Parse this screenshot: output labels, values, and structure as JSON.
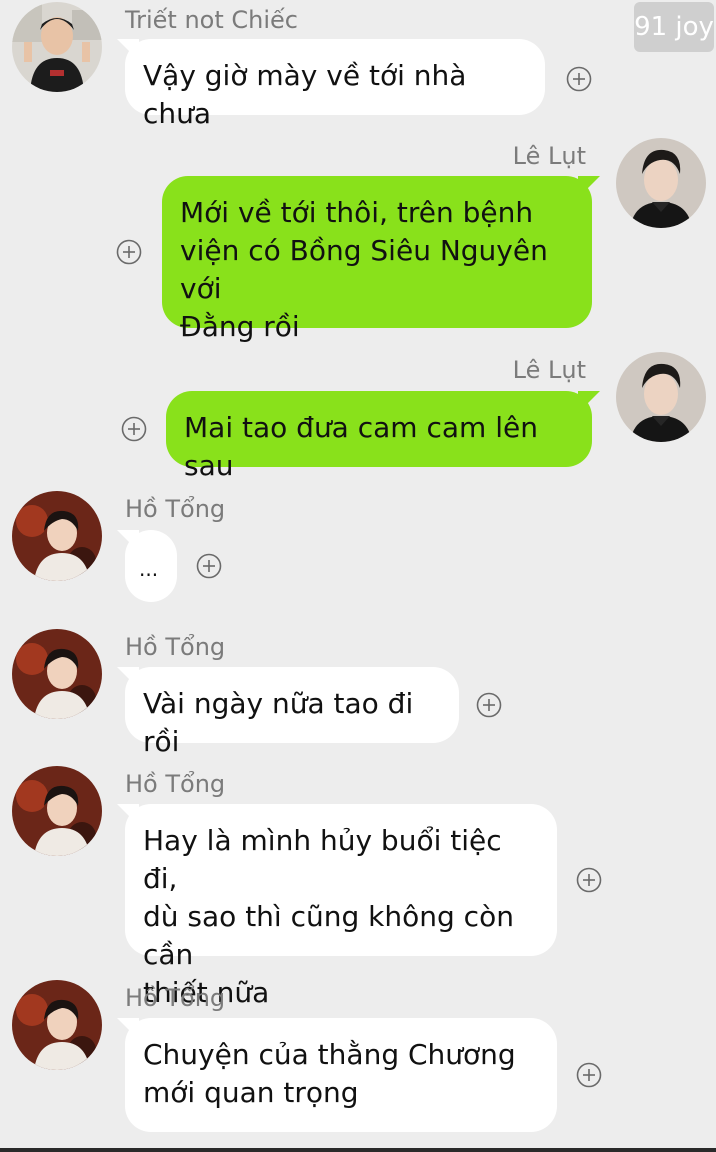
{
  "watermark": "91 joy",
  "messages": [
    {
      "sender": "Triết not Chiếc",
      "text": "Vậy giờ mày về tới nhà chưa",
      "side": "left"
    },
    {
      "sender": "Lê Lụt",
      "text": "Mới về tới thôi, trên bệnh\nviện có Bồng Siêu Nguyên với\nĐằng rồi",
      "side": "right"
    },
    {
      "sender": "Lê Lụt",
      "text": "Mai tao đưa cam cam lên sau",
      "side": "right"
    },
    {
      "sender": "Hồ Tổng",
      "text": "...",
      "side": "left"
    },
    {
      "sender": "Hồ Tổng",
      "text": "Vài ngày nữa tao đi rồi",
      "side": "left"
    },
    {
      "sender": "Hồ Tổng",
      "text": "Hay là mình hủy buổi tiệc đi,\ndù sao thì cũng không còn cần\nthiết nữa",
      "side": "left"
    },
    {
      "sender": "Hồ Tổng",
      "text": "Chuyện của thằng Chương\nmới quan trọng",
      "side": "left"
    }
  ],
  "colors": {
    "background": "#ededed",
    "sent_bubble": "#89e11b",
    "received_bubble": "#ffffff"
  },
  "icons": {
    "add": "plus-circle-icon"
  }
}
